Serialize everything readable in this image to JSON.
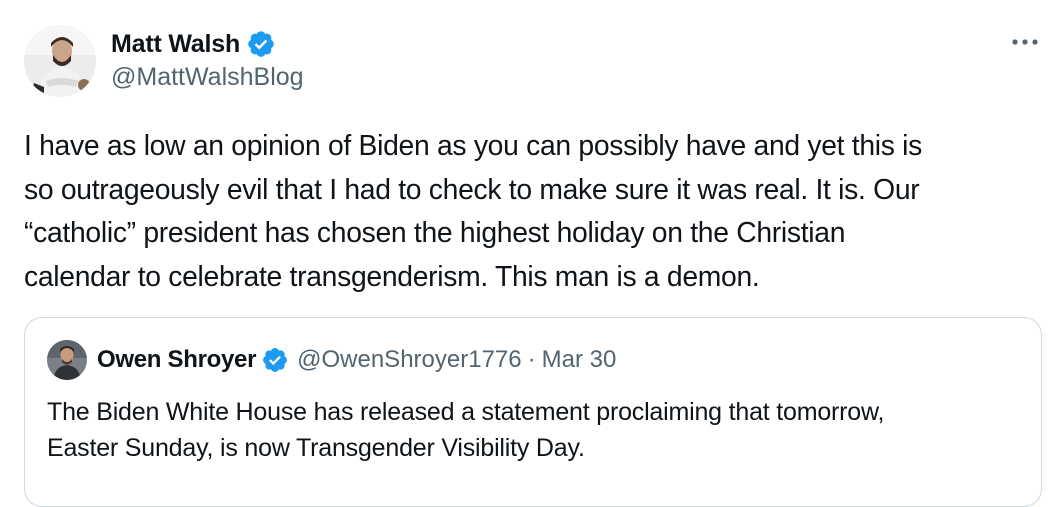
{
  "author": {
    "name": "Matt Walsh",
    "handle": "@MattWalshBlog",
    "verified": true
  },
  "icons": {
    "verified": "verified-badge-icon",
    "more": "more-options-icon"
  },
  "colors": {
    "verified_blue": "#1d9bf0",
    "secondary_text": "#536471",
    "border": "#cfd9de"
  },
  "tweet": {
    "text": "I have as low an opinion of Biden as you can possibly have and yet this is\nso outrageously evil that I had to check to make sure it was real. It is. Our\n“catholic” president has chosen the highest holiday on the Christian\ncalendar to celebrate transgenderism. This man is a demon."
  },
  "quoted": {
    "name": "Owen Shroyer",
    "handle": "@OwenShroyer1776",
    "separator": "·",
    "date": "Mar 30",
    "text": "The Biden White House has released a statement proclaiming that tomorrow,\nEaster Sunday, is now Transgender Visibility Day."
  }
}
